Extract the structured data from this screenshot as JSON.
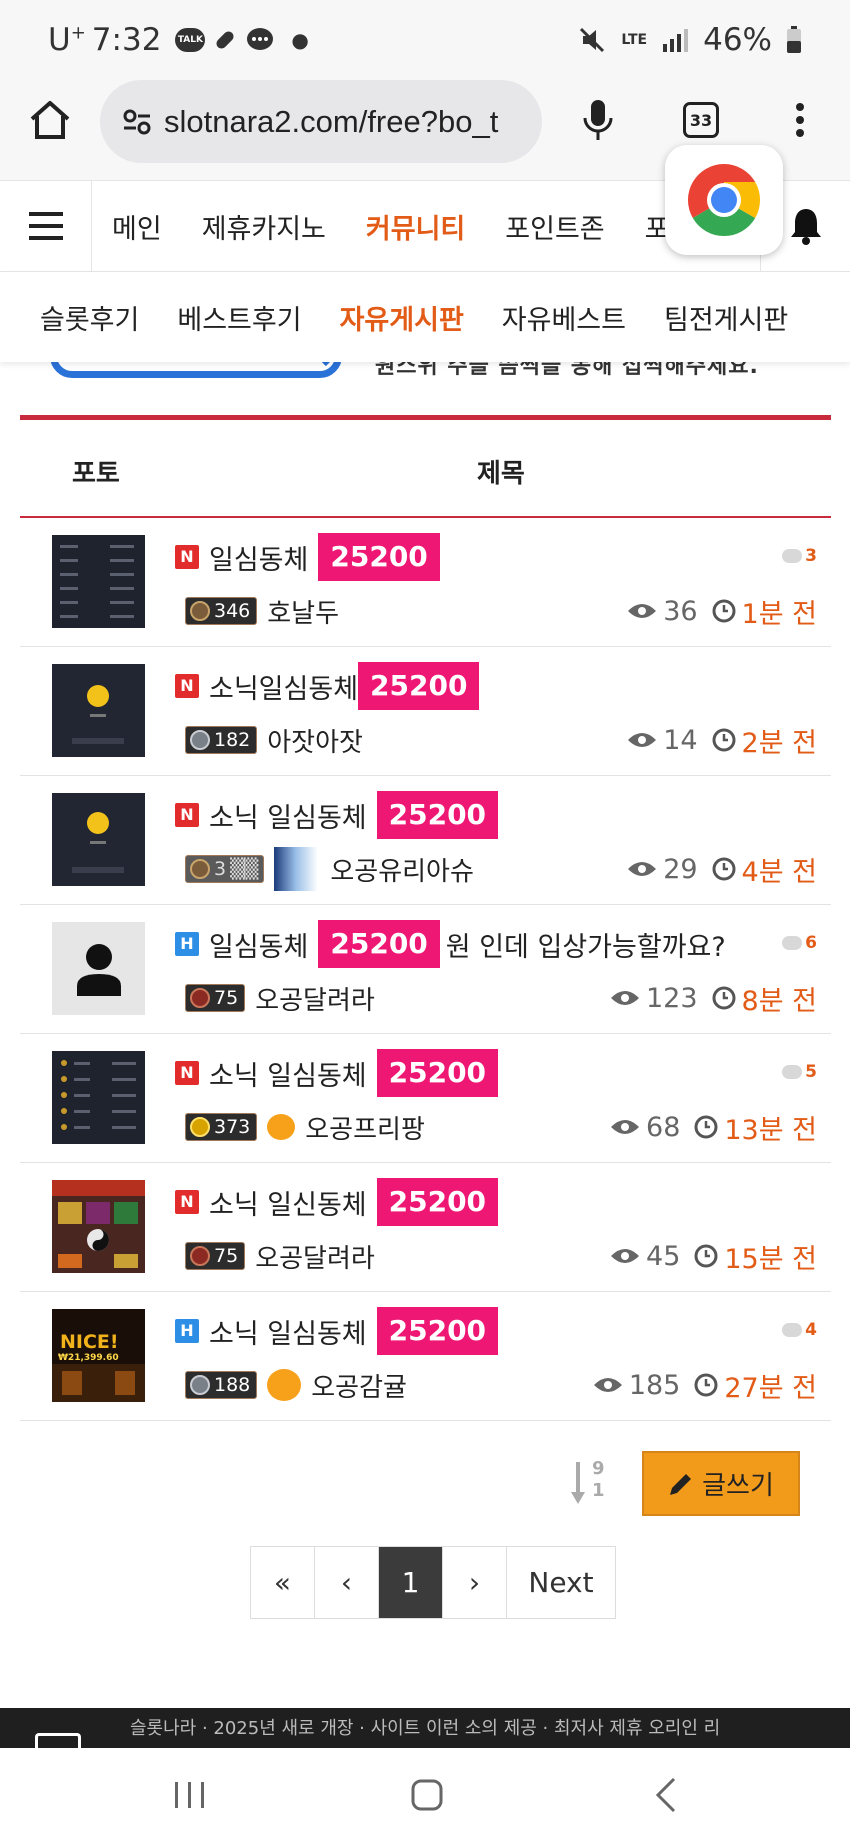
{
  "status_bar": {
    "carrier": "U",
    "carrier_sup": "+",
    "time": "7:32",
    "talk_badge": "TALK",
    "network": "LTE",
    "battery": "46%"
  },
  "browser": {
    "url": "slotnara2.com/free?bo_t",
    "tab_count": "33"
  },
  "nav_main": {
    "items": [
      "메인",
      "제휴카지노",
      "커뮤니티",
      "포인트존",
      "포"
    ],
    "active_index": 2
  },
  "nav_sub": {
    "items": [
      "슬롯후기",
      "베스트후기",
      "자유게시판",
      "자유베스트",
      "팀전게시판"
    ],
    "active_index": 2
  },
  "banner": {
    "text": "원스위 주슬 씀씩슬 동해 섭씩해주세요."
  },
  "table_header": {
    "photo": "포토",
    "title": "제목"
  },
  "posts": [
    {
      "badge": "N",
      "title": "일심동체",
      "tag": "25200",
      "title_after": "",
      "comments": "3",
      "level": "346",
      "level_style": "bronze",
      "author": "호날두",
      "views": "36",
      "time": "1분 전",
      "thumb": "dark-list"
    },
    {
      "badge": "N",
      "title": "소닉일심동체",
      "tag": "25200",
      "title_after": "",
      "comments": "",
      "level": "182",
      "level_style": "silver",
      "author": "아잣아잣",
      "views": "14",
      "time": "2분 전",
      "thumb": "coin"
    },
    {
      "badge": "N",
      "title": "소닉 일심동체",
      "tag": "25200",
      "title_after": "",
      "comments": "",
      "level": "3",
      "level_style": "fuzzy",
      "author": "오공유리아슈",
      "views": "29",
      "time": "4분 전",
      "thumb": "coin"
    },
    {
      "badge": "H",
      "title": "일심동체",
      "tag": "25200",
      "title_after": "원 인데 입상가능할까요?",
      "comments": "6",
      "level": "75",
      "level_style": "red",
      "author": "오공달려라",
      "views": "123",
      "time": "8분 전",
      "thumb": "avatar"
    },
    {
      "badge": "N",
      "title": "소닉 일심동체",
      "tag": "25200",
      "title_after": "",
      "comments": "5",
      "level": "373",
      "level_style": "gold",
      "author": "오공프리팡",
      "views": "68",
      "time": "13분 전",
      "thumb": "dark-list"
    },
    {
      "badge": "N",
      "title": "소닉 일신동체",
      "tag": "25200",
      "title_after": "",
      "comments": "",
      "level": "75",
      "level_style": "red",
      "author": "오공달려라",
      "views": "45",
      "time": "15분 전",
      "thumb": "slot"
    },
    {
      "badge": "H",
      "title": "소닉 일심동체",
      "tag": "25200",
      "title_after": "",
      "comments": "4",
      "level": "188",
      "level_style": "silver",
      "author": "오공감귤",
      "views": "185",
      "time": "27분 전",
      "thumb": "win"
    }
  ],
  "thumb_text": {
    "win_title": "NICE!",
    "win_amount": "₩21,399.60"
  },
  "sort": {
    "top": "9",
    "bottom": "1"
  },
  "write_button": "글쓰기",
  "pagination": {
    "first": "«",
    "prev": "‹",
    "current": "1",
    "next_arrow": "›",
    "next": "Next"
  },
  "footer": {
    "text": "슬롯나라 · 2025년 새로 개장 · 사이트 이런 소의 제공 · 최저사 제휴 오리인 리"
  },
  "colors": {
    "accent": "#e25b17",
    "tag": "#ef1774",
    "rule": "#c72b3c",
    "write": "#f29b1a"
  }
}
